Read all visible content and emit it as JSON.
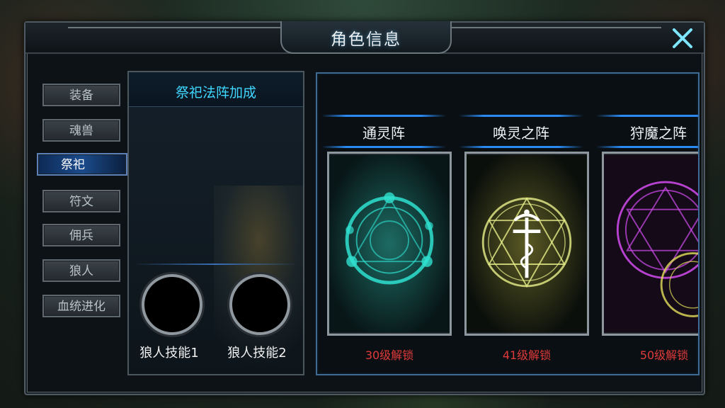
{
  "window": {
    "title": "角色信息"
  },
  "sidebar": {
    "items": [
      {
        "label": "装备",
        "active": false
      },
      {
        "label": "魂兽",
        "active": false
      },
      {
        "label": "祭祀",
        "active": true
      },
      {
        "label": "符文",
        "active": false
      },
      {
        "label": "佣兵",
        "active": false
      },
      {
        "label": "狼人",
        "active": false
      },
      {
        "label": "血统进化",
        "active": false
      }
    ]
  },
  "sacrifice_panel": {
    "title": "祭祀法阵加成",
    "slots": [
      {
        "label": "狼人技能1"
      },
      {
        "label": "狼人技能2"
      }
    ]
  },
  "formations": [
    {
      "name": "通灵阵",
      "unlock": "30级解锁",
      "color": "#2fe0d0"
    },
    {
      "name": "唤灵之阵",
      "unlock": "41级解锁",
      "color": "#e8f08a"
    },
    {
      "name": "狩魔之阵",
      "unlock": "50级解锁",
      "color": "#d24cf0"
    }
  ],
  "colors": {
    "accent_blue": "#2a8af2",
    "bonus_title": "#3fd7ff",
    "unlock_red": "#e03a3a",
    "close_icon": "#7ee6ff"
  }
}
